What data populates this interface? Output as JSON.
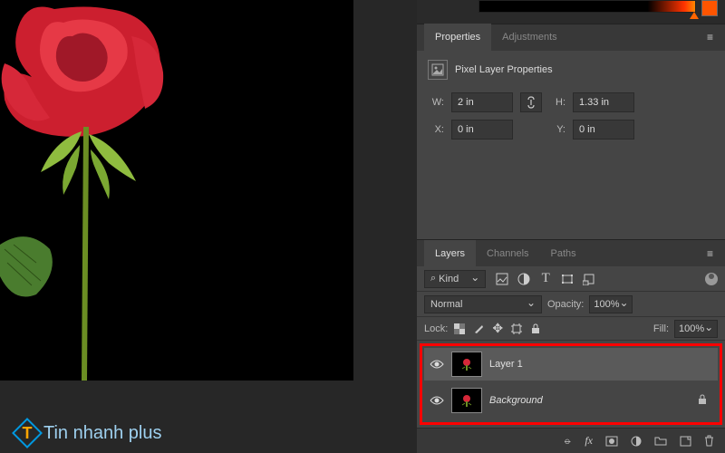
{
  "watermark": "Tin nhanh plus",
  "colorStrip": {
    "swatch": "#ff5500"
  },
  "properties": {
    "tabs": [
      "Properties",
      "Adjustments"
    ],
    "activeTab": 0,
    "title": "Pixel Layer Properties",
    "w_label": "W:",
    "w_value": "2 in",
    "h_label": "H:",
    "h_value": "1.33 in",
    "x_label": "X:",
    "x_value": "0 in",
    "y_label": "Y:",
    "y_value": "0 in"
  },
  "layers": {
    "tabs": [
      "Layers",
      "Channels",
      "Paths"
    ],
    "activeTab": 0,
    "kind_label": "Kind",
    "blend_mode": "Normal",
    "opacity_label": "Opacity:",
    "opacity_value": "100%",
    "lock_label": "Lock:",
    "fill_label": "Fill:",
    "fill_value": "100%",
    "items": [
      {
        "name": "Layer 1",
        "locked": false,
        "selected": true
      },
      {
        "name": "Background",
        "locked": true,
        "selected": false,
        "italic": true
      }
    ]
  }
}
